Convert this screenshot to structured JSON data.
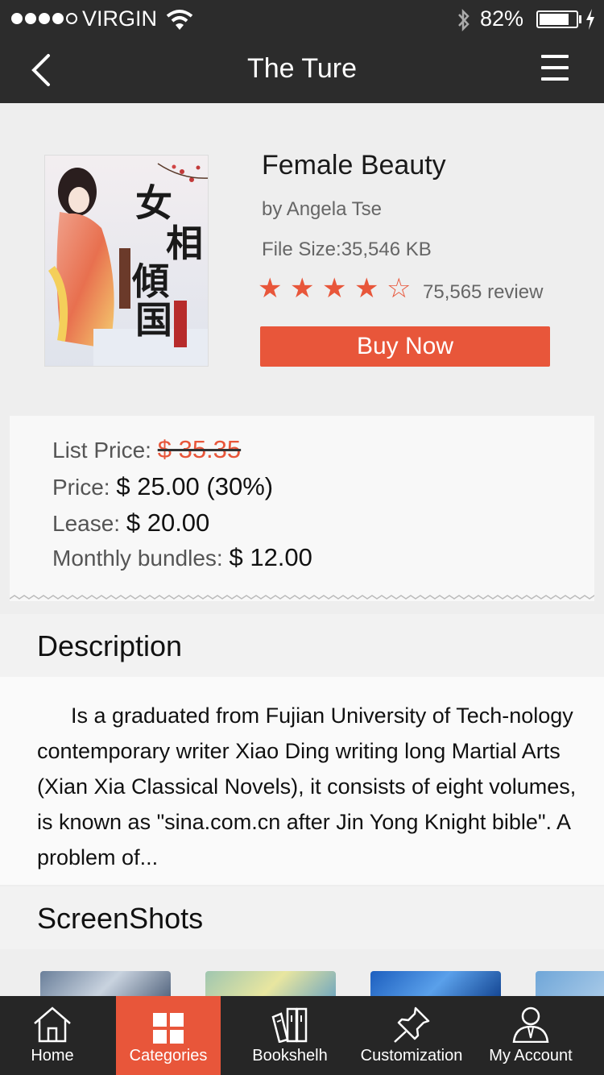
{
  "status_bar": {
    "carrier": "VIRGIN",
    "battery_percent": "82%",
    "battery_level": 0.82
  },
  "nav": {
    "title": "The Ture",
    "back_icon": "chevron-left-icon",
    "menu_icon": "hamburger-menu-icon"
  },
  "book": {
    "title": "Female Beauty",
    "author": "by Angela Tse",
    "file_size": "File Size:35,546 KB",
    "rating": 4,
    "rating_max": 5,
    "reviews": "75,565 review",
    "buy_label": "Buy Now",
    "cover_text": "女相傾国"
  },
  "pricing": {
    "list_label": "List Price:",
    "list_value": "$ 35.35",
    "price_label": "Price:",
    "price_value": "$ 25.00 (30%)",
    "lease_label": "Lease:",
    "lease_value": "$ 20.00",
    "bundle_label": "Monthly bundles:",
    "bundle_value": "$ 12.00"
  },
  "description": {
    "heading": "Description",
    "text": "Is a graduated from Fujian University of Tech-nology contemporary writer Xiao Ding writing long Martial Arts (Xian Xia Classical Novels), it consists of eight volumes, is known as \"sina.com.cn after Jin Yong Knight bible\". A problem of..."
  },
  "screenshots": {
    "heading": "ScreenShots"
  },
  "tabbar": {
    "home": "Home",
    "categories": "Categories",
    "bookshelf": "Bookshelh",
    "customization": "Customization",
    "account": "My Account",
    "active": "categories"
  },
  "colors": {
    "accent": "#e8563a",
    "header": "#2c2c2c",
    "tabbar": "#262626"
  }
}
